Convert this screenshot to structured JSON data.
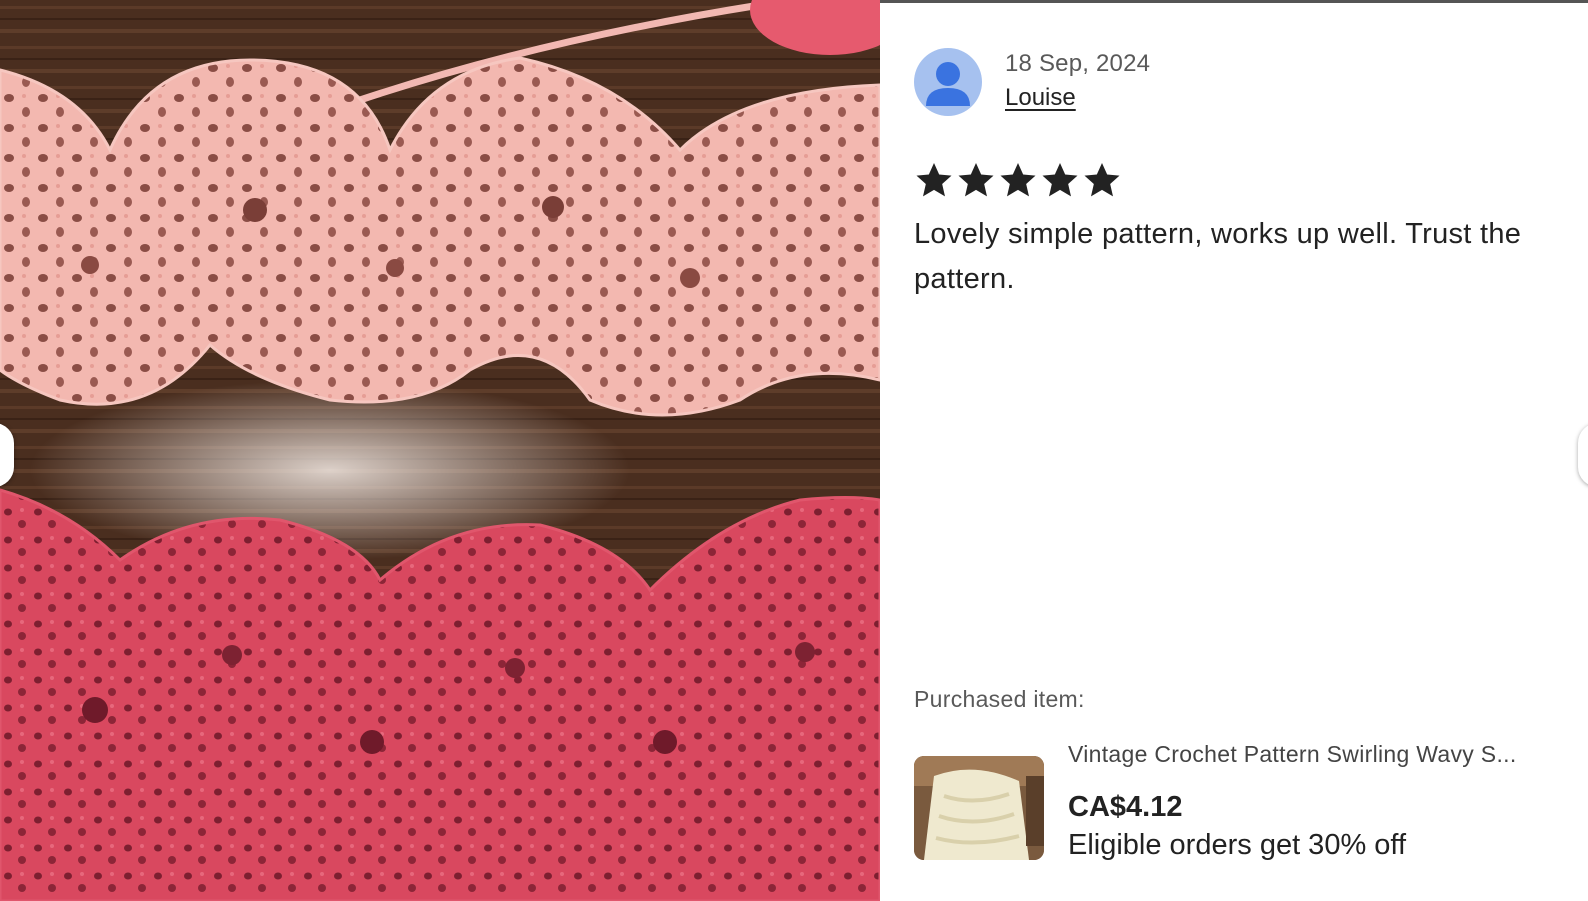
{
  "photo": {
    "icon": "crochet-photo",
    "colors": {
      "wood": "#4a2e1f",
      "light_pink": "#f2b4ad",
      "dark_pink": "#d8475e"
    }
  },
  "carousel": {
    "prev_icon": "chevron-left-icon",
    "next_icon": "chevron-right-icon"
  },
  "review": {
    "avatar_icon": "user-avatar-icon",
    "date": "18 Sep, 2024",
    "reviewer": "Louise",
    "rating": 5,
    "rating_max": 5,
    "star_icon": "star-icon",
    "text": "Lovely simple pattern, works up well. Trust the pattern."
  },
  "purchased": {
    "label": "Purchased item:",
    "item": {
      "thumbnail_icon": "product-thumbnail",
      "title": "Vintage Crochet Pattern Swirling Wavy S...",
      "price": "CA$4.12",
      "promo": "Eligible orders get 30% off"
    }
  },
  "colors": {
    "text_primary": "#222222",
    "text_secondary": "#595959",
    "avatar_bg": "#a6c1ef",
    "avatar_fg": "#3a73e0"
  }
}
